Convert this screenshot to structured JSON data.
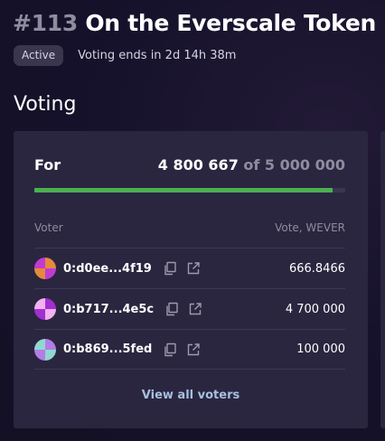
{
  "proposal": {
    "number": "#113",
    "title": "On the Everscale Token Reco",
    "status": "Active",
    "voting_ends": "Voting ends in 2d 14h 38m"
  },
  "section_title": "Voting",
  "card": {
    "for_label": "For",
    "for_value": "4 800 667",
    "for_of": "of 5 000 000",
    "progress_fraction": 0.96,
    "progress_color": "#4cb04f",
    "columns": {
      "voter": "Voter",
      "vote": "Vote, WEVER"
    },
    "voters": [
      {
        "address": "0:d0ee...4f19",
        "vote": "666.8466",
        "avatar_colors": [
          "#e48a3a",
          "#c23ad4"
        ]
      },
      {
        "address": "0:b717...4e5c",
        "vote": "4 700 000",
        "avatar_colors": [
          "#a22fd0",
          "#f0b2f0"
        ]
      },
      {
        "address": "0:b869...5fed",
        "vote": "100 000",
        "avatar_colors": [
          "#b37de6",
          "#8fd8d0"
        ]
      }
    ],
    "view_all_label": "View all voters"
  }
}
